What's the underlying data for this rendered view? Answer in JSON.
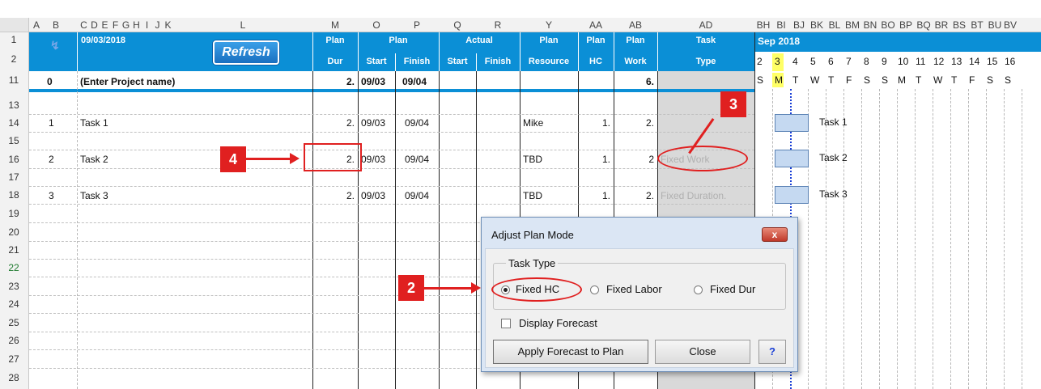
{
  "columns": [
    "A",
    "B",
    "C",
    "D",
    "E",
    "F",
    "G",
    "H",
    "I",
    "J",
    "K",
    "L",
    "M",
    "O",
    "P",
    "Q",
    "R",
    "Y",
    "AA",
    "AB",
    "AD",
    "BH",
    "BI",
    "BJ",
    "BK",
    "BL",
    "BM",
    "BN",
    "BO",
    "BP",
    "BQ",
    "BR",
    "BS",
    "BT",
    "BU",
    "BV"
  ],
  "rows": [
    "1",
    "2",
    "11",
    "13",
    "14",
    "15",
    "16",
    "17",
    "18",
    "19",
    "20",
    "21",
    "22",
    "23",
    "24",
    "25",
    "26",
    "27",
    "28"
  ],
  "header": {
    "date": "09/03/2018",
    "refresh_label": "Refresh",
    "plan_dur_1": "Plan",
    "plan_dur_2": "Dur",
    "plan_group": "Plan",
    "plan_start": "Start",
    "plan_finish": "Finish",
    "actual_group": "Actual",
    "actual_start": "Start",
    "actual_finish": "Finish",
    "plan_resource_1": "Plan",
    "plan_resource_2": "Resource",
    "plan_hc_1": "Plan",
    "plan_hc_2": "HC",
    "plan_work_1": "Plan",
    "plan_work_2": "Work",
    "task_type_1": "Task",
    "task_type_2": "Type",
    "month": "Sep 2018"
  },
  "gantt_days": [
    "2",
    "3",
    "4",
    "5",
    "6",
    "7",
    "8",
    "9",
    "10",
    "11",
    "12",
    "13",
    "14",
    "15",
    "16"
  ],
  "gantt_weekdays": [
    "S",
    "M",
    "T",
    "W",
    "T",
    "F",
    "S",
    "S",
    "M",
    "T",
    "W",
    "T",
    "F",
    "S",
    "S"
  ],
  "summary_row": {
    "id": "0",
    "name": "(Enter Project name)",
    "dur": "2.",
    "start": "09/03",
    "finish": "09/04",
    "work": "6."
  },
  "tasks": [
    {
      "id": "1",
      "name": "Task 1",
      "dur": "2.",
      "start": "09/03",
      "finish": "09/04",
      "resource": "Mike",
      "hc": "1.",
      "work": "2.",
      "type": "",
      "bar_label": "Task 1"
    },
    {
      "id": "2",
      "name": "Task 2",
      "dur": "2.",
      "start": "09/03",
      "finish": "09/04",
      "resource": "TBD",
      "hc": "1.",
      "work": "2",
      "type": "Fixed Work",
      "bar_label": "Task 2"
    },
    {
      "id": "3",
      "name": "Task 3",
      "dur": "2.",
      "start": "09/03",
      "finish": "09/04",
      "resource": "TBD",
      "hc": "1.",
      "work": "2.",
      "type": "Fixed Duration.",
      "bar_label": "Task 3"
    }
  ],
  "dialog": {
    "title": "Adjust Plan Mode",
    "close_x": "x",
    "group_label": "Task Type",
    "option_fixed_hc": "Fixed HC",
    "option_fixed_labor": "Fixed Labor",
    "option_fixed_dur": "Fixed Dur",
    "selected": "Fixed HC",
    "display_forecast_label": "Display Forecast",
    "display_forecast_checked": false,
    "apply_label": "Apply Forecast to Plan",
    "close_label": "Close",
    "help_label": "?"
  },
  "callouts": {
    "c2": "2",
    "c3": "3",
    "c4": "4"
  },
  "colors": {
    "header_blue": "#0b8fd6",
    "callout_red": "#e02020",
    "bar_fill": "#c5d9f1",
    "today_yellow": "#ffff66"
  }
}
